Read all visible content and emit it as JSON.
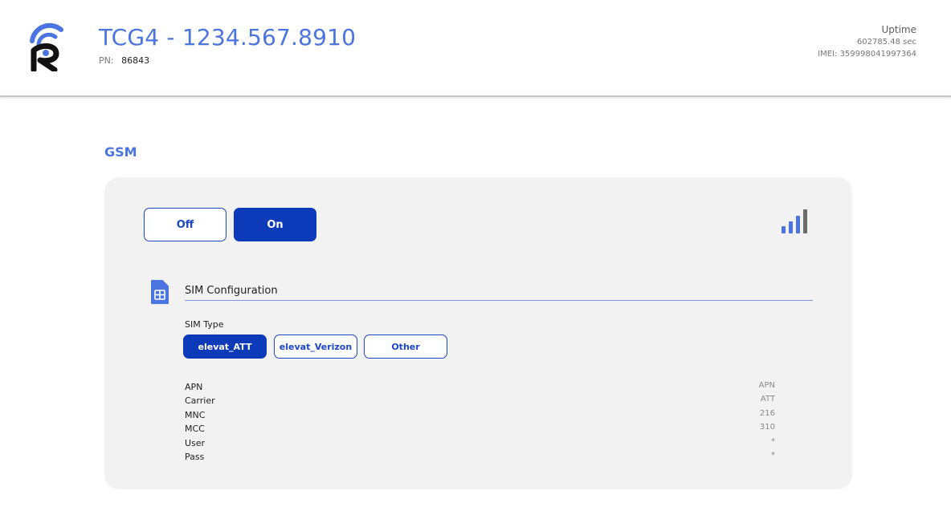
{
  "header": {
    "device_title": "TCG4 - 1234.567.8910",
    "pn_label": "PN:",
    "pn_value": "86843",
    "uptime_label": "Uptime",
    "uptime_value": "602785.48 sec",
    "imei": "IMEI: 359998041997364",
    "logo_icon": "radio-r-logo-icon",
    "accent_color": "#4a75e0"
  },
  "section": {
    "title": "GSM"
  },
  "power": {
    "off_label": "Off",
    "on_label": "On",
    "selected": "On",
    "signal_icon": "signal-strength-icon",
    "signal_bars_active": 3,
    "signal_bars_total": 4
  },
  "sim": {
    "icon": "sim-card-icon",
    "config_title": "SIM Configuration",
    "type_label": "SIM Type",
    "types": [
      "elevat_ATT",
      "elevat_Verizon",
      "Other"
    ],
    "selected_type": "elevat_ATT"
  },
  "fields": {
    "labels": [
      "APN",
      "Carrier",
      "MNC",
      "MCC",
      "User",
      "Pass"
    ],
    "values": [
      "APN",
      "ATT",
      "216",
      "310",
      "*",
      "*"
    ]
  },
  "colors": {
    "primary": "#0c3ab8",
    "card_bg": "#f2f2f3"
  }
}
